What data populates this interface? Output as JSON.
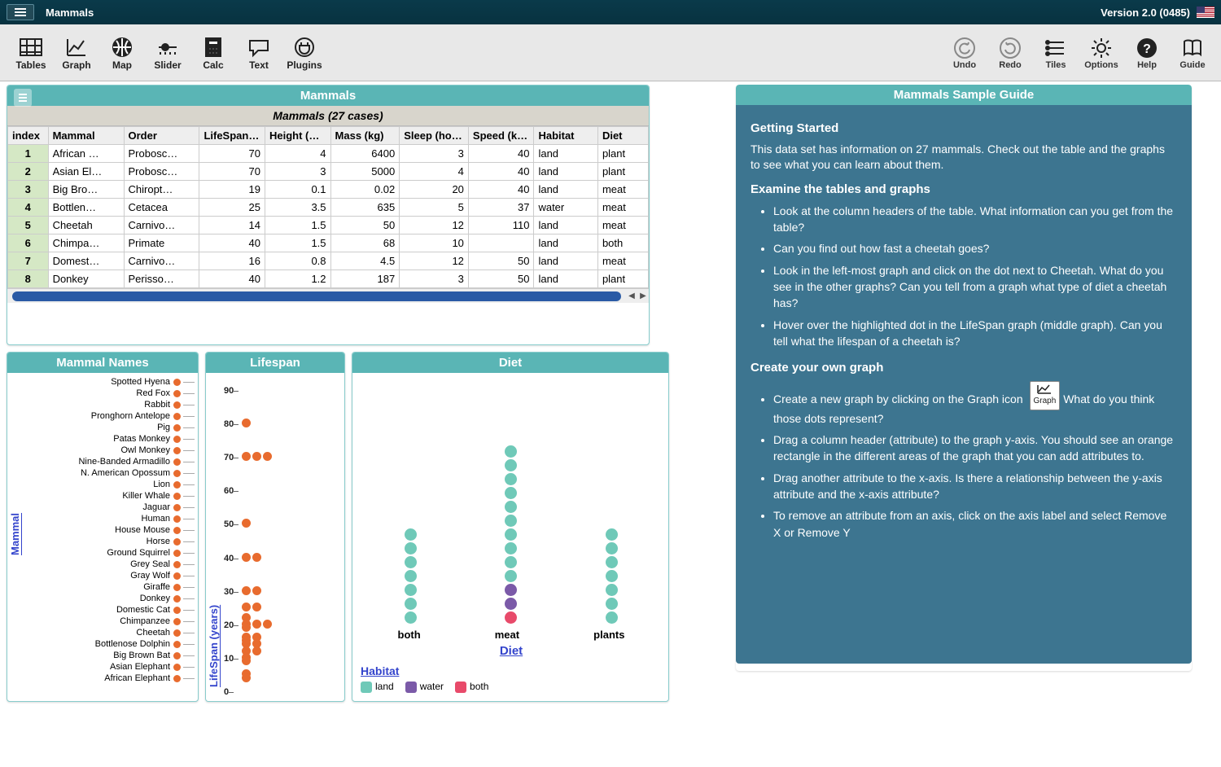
{
  "app": {
    "title": "Mammals",
    "version": "Version 2.0 (0485)"
  },
  "toolbar": {
    "left": [
      {
        "id": "tables",
        "label": "Tables"
      },
      {
        "id": "graph",
        "label": "Graph"
      },
      {
        "id": "map",
        "label": "Map"
      },
      {
        "id": "slider",
        "label": "Slider"
      },
      {
        "id": "calc",
        "label": "Calc"
      },
      {
        "id": "text",
        "label": "Text"
      },
      {
        "id": "plugins",
        "label": "Plugins"
      }
    ],
    "right": [
      {
        "id": "undo",
        "label": "Undo"
      },
      {
        "id": "redo",
        "label": "Redo"
      },
      {
        "id": "tiles",
        "label": "Tiles"
      },
      {
        "id": "options",
        "label": "Options"
      },
      {
        "id": "help",
        "label": "Help"
      },
      {
        "id": "guide",
        "label": "Guide"
      }
    ]
  },
  "tablePanel": {
    "title": "Mammals",
    "caption": "Mammals (27 cases)",
    "columns": [
      "index",
      "Mammal",
      "Order",
      "LifeSpan (years)",
      "Height (meters)",
      "Mass (kg)",
      "Sleep (hours)",
      "Speed (km/h)",
      "Habitat",
      "Diet"
    ],
    "rows": [
      {
        "index": 1,
        "mammal": "African …",
        "order": "Probosc…",
        "lifespan": 70,
        "height": 4,
        "mass": 6400,
        "sleep": 3,
        "speed": 40,
        "habitat": "land",
        "diet": "plant"
      },
      {
        "index": 2,
        "mammal": "Asian El…",
        "order": "Probosc…",
        "lifespan": 70,
        "height": 3,
        "mass": 5000,
        "sleep": 4,
        "speed": 40,
        "habitat": "land",
        "diet": "plant"
      },
      {
        "index": 3,
        "mammal": "Big Bro…",
        "order": "Chiropt…",
        "lifespan": 19,
        "height": 0.1,
        "mass": 0.02,
        "sleep": 20,
        "speed": 40,
        "habitat": "land",
        "diet": "meat"
      },
      {
        "index": 4,
        "mammal": "Bottlen…",
        "order": "Cetacea",
        "lifespan": 25,
        "height": 3.5,
        "mass": 635,
        "sleep": 5,
        "speed": 37,
        "habitat": "water",
        "diet": "meat"
      },
      {
        "index": 5,
        "mammal": "Cheetah",
        "order": "Carnivo…",
        "lifespan": 14,
        "height": 1.5,
        "mass": 50,
        "sleep": 12,
        "speed": 110,
        "habitat": "land",
        "diet": "meat"
      },
      {
        "index": 6,
        "mammal": "Chimpa…",
        "order": "Primate",
        "lifespan": 40,
        "height": 1.5,
        "mass": 68,
        "sleep": 10,
        "speed": "",
        "habitat": "land",
        "diet": "both"
      },
      {
        "index": 7,
        "mammal": "Domest…",
        "order": "Carnivo…",
        "lifespan": 16,
        "height": 0.8,
        "mass": 4.5,
        "sleep": 12,
        "speed": 50,
        "habitat": "land",
        "diet": "meat"
      },
      {
        "index": 8,
        "mammal": "Donkey",
        "order": "Perisso…",
        "lifespan": 40,
        "height": 1.2,
        "mass": 187,
        "sleep": 3,
        "speed": 50,
        "habitat": "land",
        "diet": "plant"
      }
    ]
  },
  "namesPanel": {
    "title": "Mammal Names",
    "axis": "Mammal",
    "names": [
      "Spotted Hyena",
      "Red Fox",
      "Rabbit",
      "Pronghorn Antelope",
      "Pig",
      "Patas Monkey",
      "Owl Monkey",
      "Nine-Banded Armadillo",
      "N. American Opossum",
      "Lion",
      "Killer Whale",
      "Jaguar",
      "Human",
      "House Mouse",
      "Horse",
      "Ground Squirrel",
      "Grey Seal",
      "Gray Wolf",
      "Giraffe",
      "Donkey",
      "Domestic Cat",
      "Chimpanzee",
      "Cheetah",
      "Bottlenose Dolphin",
      "Big Brown Bat",
      "Asian Elephant",
      "African Elephant"
    ]
  },
  "lifespanPanel": {
    "title": "Lifespan",
    "axis": "LifeSpan (years)"
  },
  "dietPanel": {
    "title": "Diet",
    "axis": "Diet",
    "categories": [
      "both",
      "meat",
      "plants"
    ],
    "legendTitle": "Habitat",
    "legend": [
      {
        "label": "land",
        "class": "c-land"
      },
      {
        "label": "water",
        "class": "c-water"
      },
      {
        "label": "both",
        "class": "c-both"
      }
    ]
  },
  "guidePanel": {
    "title": "Mammals Sample Guide",
    "h1": "Getting Started",
    "p1": "This data set has information on 27 mammals. Check out the table and the graphs to see what you can learn about them.",
    "h2": "Examine the tables and graphs",
    "bullets1": [
      "Look at the column headers of the table. What information can you get from the table?",
      "Can you find out how fast a cheetah goes?",
      "Look in the left-most graph and click on the dot next to Cheetah. What do you see in the other graphs? Can you tell from a graph what type of diet a cheetah has?",
      "Hover over the highlighted dot in the LifeSpan graph (middle graph). Can you tell what the lifespan of a cheetah is?"
    ],
    "h3": "Create your own graph",
    "graphIconLabel": "Graph",
    "bullets2_first_pre": "Create a new graph by clicking on the Graph icon ",
    "bullets2_first_post": " What do you think those dots represent?",
    "bullets2_rest": [
      "Drag a column header (attribute) to the graph y-axis. You should see an orange rectangle in the different areas of the graph that you can add attributes to.",
      "Drag another attribute to the x-axis. Is there a relationship between the y-axis attribute and the x-axis attribute?",
      "To remove an attribute from an axis, click on the axis label and select Remove X or Remove Y"
    ]
  },
  "chart_data": [
    {
      "type": "dot",
      "title": "Mammal Names",
      "ylabel": "Mammal",
      "categories": [
        "Spotted Hyena",
        "Red Fox",
        "Rabbit",
        "Pronghorn Antelope",
        "Pig",
        "Patas Monkey",
        "Owl Monkey",
        "Nine-Banded Armadillo",
        "N. American Opossum",
        "Lion",
        "Killer Whale",
        "Jaguar",
        "Human",
        "House Mouse",
        "Horse",
        "Ground Squirrel",
        "Grey Seal",
        "Gray Wolf",
        "Giraffe",
        "Donkey",
        "Domestic Cat",
        "Chimpanzee",
        "Cheetah",
        "Bottlenose Dolphin",
        "Big Brown Bat",
        "Asian Elephant",
        "African Elephant"
      ],
      "values": [
        1,
        1,
        1,
        1,
        1,
        1,
        1,
        1,
        1,
        1,
        1,
        1,
        1,
        1,
        1,
        1,
        1,
        1,
        1,
        1,
        1,
        1,
        1,
        1,
        1,
        1,
        1
      ]
    },
    {
      "type": "dot",
      "title": "Lifespan",
      "ylabel": "LifeSpan (years)",
      "ylim": [
        0,
        90
      ],
      "yticks": [
        0,
        10,
        20,
        30,
        40,
        50,
        60,
        70,
        80,
        90
      ],
      "points": [
        {
          "y": 80
        },
        {
          "y": 70
        },
        {
          "y": 70
        },
        {
          "y": 70
        },
        {
          "y": 50
        },
        {
          "y": 40
        },
        {
          "y": 40
        },
        {
          "y": 30
        },
        {
          "y": 30
        },
        {
          "y": 25
        },
        {
          "y": 25
        },
        {
          "y": 22
        },
        {
          "y": 20
        },
        {
          "y": 20
        },
        {
          "y": 20
        },
        {
          "y": 19
        },
        {
          "y": 16
        },
        {
          "y": 16
        },
        {
          "y": 15
        },
        {
          "y": 14
        },
        {
          "y": 14
        },
        {
          "y": 12
        },
        {
          "y": 12
        },
        {
          "y": 10
        },
        {
          "y": 9
        },
        {
          "y": 5
        },
        {
          "y": 4
        }
      ]
    },
    {
      "type": "dot",
      "title": "Diet",
      "xlabel": "Diet",
      "categories": [
        "both",
        "meat",
        "plants"
      ],
      "legend_title": "Habitat",
      "legend": [
        "land",
        "water",
        "both"
      ],
      "series": [
        {
          "name": "both",
          "stacks": [
            {
              "habitat": "land",
              "count": 7
            }
          ]
        },
        {
          "name": "meat",
          "stacks": [
            {
              "habitat": "both",
              "count": 1
            },
            {
              "habitat": "water",
              "count": 2
            },
            {
              "habitat": "land",
              "count": 10
            }
          ]
        },
        {
          "name": "plants",
          "stacks": [
            {
              "habitat": "land",
              "count": 7
            }
          ]
        }
      ]
    }
  ]
}
